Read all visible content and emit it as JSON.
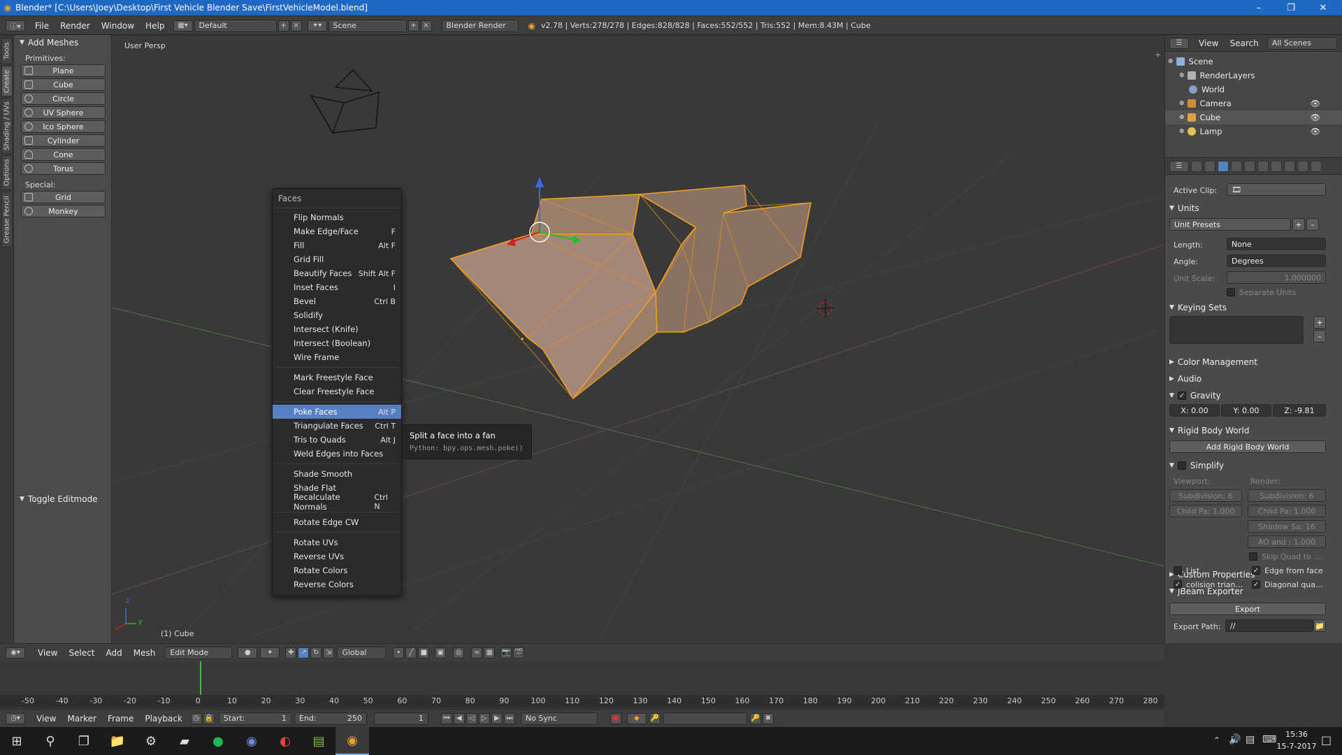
{
  "window": {
    "title": "Blender* [C:\\Users\\Joey\\Desktop\\First Vehicle Blender Save\\FirstVehicleModel.blend]",
    "minimize": "–",
    "restore": "❐",
    "close": "✕"
  },
  "info": {
    "menus": [
      "File",
      "Render",
      "Window",
      "Help"
    ],
    "layout": "Default",
    "scene": "Scene",
    "engine": "Blender Render",
    "stats": "v2.78 | Verts:278/278 | Edges:828/828 | Faces:552/552 | Tris:552 | Mem:8.43M | Cube"
  },
  "tools": {
    "tabs": [
      "Tools",
      "Create",
      "Shading / UVs",
      "Options",
      "Grease Pencil"
    ],
    "panel": "Add Meshes",
    "primitives_label": "Primitives:",
    "primitives": [
      "Plane",
      "Cube",
      "Circle",
      "UV Sphere",
      "Ico Sphere",
      "Cylinder",
      "Cone",
      "Torus"
    ],
    "special_label": "Special:",
    "special": [
      "Grid",
      "Monkey"
    ],
    "toggle": "Toggle Editmode"
  },
  "viewport": {
    "view_label": "User Persp",
    "object_label": "(1) Cube",
    "axis_x": "x",
    "axis_y": "y",
    "axis_z": "z"
  },
  "menu": {
    "title": "Faces",
    "groups": [
      [
        {
          "label": "Flip Normals",
          "shortcut": ""
        },
        {
          "label": "Make Edge/Face",
          "shortcut": "F"
        },
        {
          "label": "Fill",
          "shortcut": "Alt F"
        },
        {
          "label": "Grid Fill",
          "shortcut": ""
        },
        {
          "label": "Beautify Faces",
          "shortcut": "Shift Alt F"
        },
        {
          "label": "Inset Faces",
          "shortcut": "I"
        },
        {
          "label": "Bevel",
          "shortcut": "Ctrl B"
        },
        {
          "label": "Solidify",
          "shortcut": ""
        },
        {
          "label": "Intersect (Knife)",
          "shortcut": ""
        },
        {
          "label": "Intersect (Boolean)",
          "shortcut": ""
        },
        {
          "label": "Wire Frame",
          "shortcut": ""
        }
      ],
      [
        {
          "label": "Mark Freestyle Face",
          "shortcut": ""
        },
        {
          "label": "Clear Freestyle Face",
          "shortcut": ""
        }
      ],
      [
        {
          "label": "Poke Faces",
          "shortcut": "Alt P",
          "selected": true
        },
        {
          "label": "Triangulate Faces",
          "shortcut": "Ctrl T"
        },
        {
          "label": "Tris to Quads",
          "shortcut": "Alt J"
        },
        {
          "label": "Weld Edges into Faces",
          "shortcut": ""
        }
      ],
      [
        {
          "label": "Shade Smooth",
          "shortcut": ""
        },
        {
          "label": "Shade Flat",
          "shortcut": ""
        },
        {
          "label": "Recalculate Normals",
          "shortcut": "Ctrl N"
        }
      ],
      [
        {
          "label": "Rotate Edge CW",
          "shortcut": ""
        }
      ],
      [
        {
          "label": "Rotate UVs",
          "shortcut": ""
        },
        {
          "label": "Reverse UVs",
          "shortcut": ""
        },
        {
          "label": "Rotate Colors",
          "shortcut": ""
        },
        {
          "label": "Reverse Colors",
          "shortcut": ""
        }
      ]
    ]
  },
  "tooltip": {
    "text": "Split a face into a fan",
    "python": "Python: bpy.ops.mesh.poke()"
  },
  "outliner": {
    "menus": [
      "View",
      "Search"
    ],
    "scope": "All Scenes",
    "items": [
      {
        "label": "Scene",
        "color": "#8fb0d8"
      },
      {
        "label": "RenderLayers",
        "color": "#b0b0b0"
      },
      {
        "label": "World",
        "color": "#7fa0c8"
      },
      {
        "label": "Camera",
        "color": "#d08a40"
      },
      {
        "label": "Cube",
        "color": "#e0a040"
      },
      {
        "label": "Lamp",
        "color": "#e8c050"
      }
    ]
  },
  "props": {
    "active_clip": "Active Clip:",
    "units": "Units",
    "unit_presets": "Unit Presets",
    "length_label": "Length:",
    "length": "None",
    "angle_label": "Angle:",
    "angle": "Degrees",
    "unit_scale_label": "Unit Scale:",
    "unit_scale": "1.000000",
    "separate_units": "Separate Units",
    "keying_sets": "Keying Sets",
    "color_management": "Color Management",
    "audio": "Audio",
    "gravity": "Gravity",
    "gx": "X:  0.00",
    "gy": "Y:  0.00",
    "gz": "Z:  -9.81",
    "rigid_body": "Rigid Body World",
    "add_rigid": "Add Rigid Body World",
    "simplify": "Simplify",
    "viewport_label": "Viewport:",
    "render_label": "Render:",
    "subdiv_v": "Subdivision:  6",
    "subdiv_r": "Subdivision:  6",
    "childpa_v": "Child Pa: 1.000",
    "childpa_r": "Child Pa: 1.000",
    "shadow": "Shadow Sa: 16",
    "ao": "AO and : 1.000",
    "skip_quad": "Skip Quad to ...",
    "custom_props": "Custom Properties",
    "jbeam": "JBeam Exporter",
    "export": "Export",
    "export_path_label": "Export Path:",
    "export_path": "//",
    "list": "List",
    "edge_from_face": "Edge from face",
    "collision": "colision trian...",
    "diagonal": "Diagonal qua..."
  },
  "view3d_header": {
    "menus": [
      "View",
      "Select",
      "Add",
      "Mesh"
    ],
    "mode": "Edit Mode",
    "orientation": "Global"
  },
  "timeline": {
    "ticks": [
      "-50",
      "-40",
      "-30",
      "-20",
      "-10",
      "0",
      "10",
      "20",
      "30",
      "40",
      "50",
      "60",
      "70",
      "80",
      "90",
      "100",
      "110",
      "120",
      "130",
      "140",
      "150",
      "160",
      "170",
      "180",
      "190",
      "200",
      "210",
      "220",
      "230",
      "240",
      "250",
      "260",
      "270",
      "280"
    ],
    "current_frame": "1",
    "menus": [
      "View",
      "Marker",
      "Frame",
      "Playback"
    ],
    "start": "Start:",
    "start_val": "1",
    "end": "End:",
    "end_val": "250",
    "sync": "No Sync"
  },
  "taskbar": {
    "time": "15:36",
    "date": "15-7-2017"
  }
}
